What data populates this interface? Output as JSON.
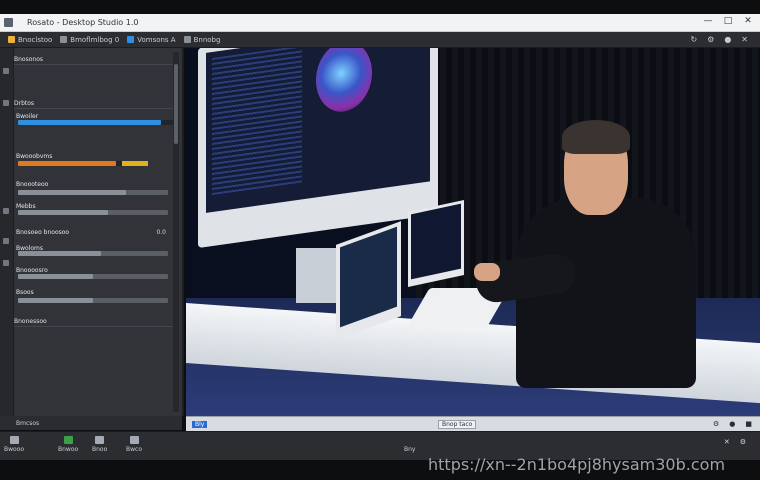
{
  "window": {
    "title": "Rosato - Desktop Studio 1.0",
    "controls": [
      "minimize-icon",
      "maximize-icon",
      "close-icon"
    ]
  },
  "toolbar": {
    "items": [
      {
        "label": "Bnoclstoo",
        "icon": "document-icon"
      },
      {
        "label": "Bmoflmlbog 0",
        "icon": "folder-icon"
      },
      {
        "label": "Vomsons A",
        "icon": "view-icon"
      },
      {
        "label": "Bnnobg",
        "icon": "play-icon"
      }
    ],
    "right_icons": [
      "refresh-icon",
      "settings-icon",
      "help-icon",
      "close-icon"
    ]
  },
  "left_panel": {
    "header": "Bnosonos",
    "section_1": "Drbtos",
    "rows": [
      {
        "label": "Bwoiler",
        "value": "",
        "bar_color": "#2f8fe0",
        "fill": 0.92
      },
      {
        "label": "Bwooobvms",
        "value": "",
        "bar_color": "#e07a1e",
        "fill": 0.75
      },
      {
        "label": "Bnoooteoo",
        "value": "",
        "bar_color": "#e0b21e",
        "fill": 0.72
      },
      {
        "label": "Mebbs",
        "value": "",
        "bar_color": "#8a9098",
        "fill": 0.6
      },
      {
        "label": "Bwoloms",
        "value": "",
        "bar_color": "#8a9098",
        "fill": 0.55
      },
      {
        "label": "Bnosoeo bnoosoo",
        "value": "0.0",
        "bar_color": "#8a9098",
        "fill": 0.4
      },
      {
        "label": "Bnoooosro",
        "value": "",
        "bar_color": "#8a9098",
        "fill": 0.5
      },
      {
        "label": "Bsoos",
        "value": "",
        "bar_color": "#8a9098",
        "fill": 0.5
      }
    ],
    "section_2": "Bnonessoo",
    "footer": "Bmcsos"
  },
  "view": {
    "zoom_label": "Bly",
    "status": "Bnop taco",
    "footer_icons": [
      "pin-icon",
      "lock-icon",
      "grid-icon"
    ]
  },
  "statusbar": {
    "items": [
      {
        "label": "Bwooo",
        "icon": "file-icon"
      },
      {
        "label": "Bnwoo",
        "icon": "battery-icon"
      },
      {
        "label": "Bnoo",
        "icon": "link-icon"
      },
      {
        "label": "Bwco",
        "icon": "camera-icon"
      }
    ],
    "center": "Bny",
    "right_icons": [
      "close-icon",
      "settings-icon"
    ]
  },
  "watermark": "https://xn--2n1bo4pj8hysam30b.com"
}
